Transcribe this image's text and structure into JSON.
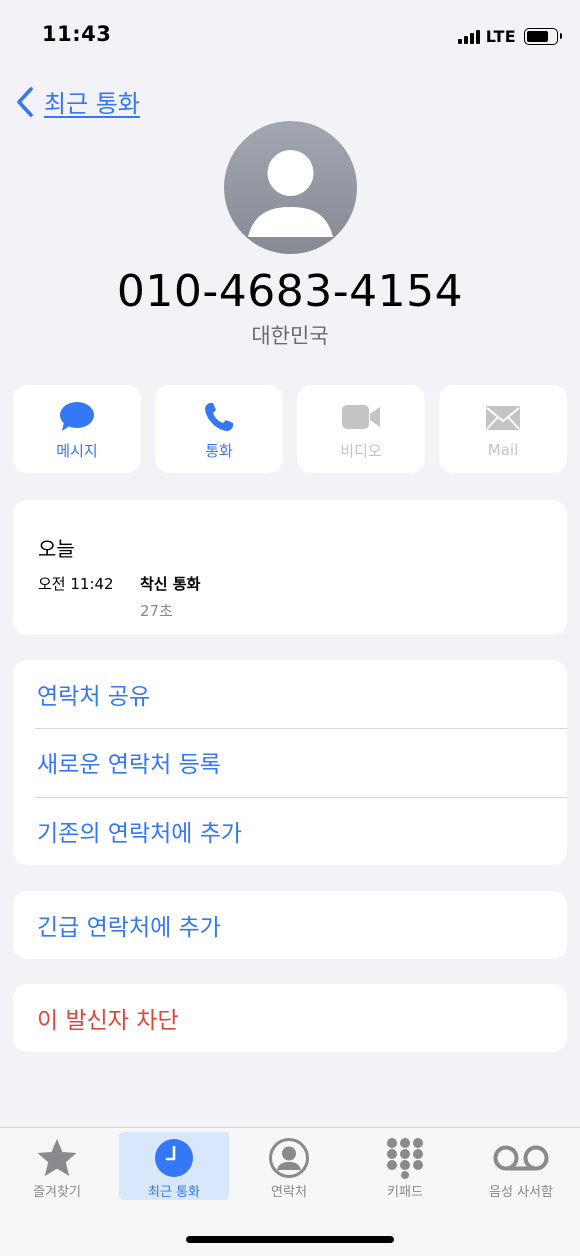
{
  "status_bar": {
    "time": "11:43",
    "network": "LTE"
  },
  "nav": {
    "back_label": "최근 통화"
  },
  "contact": {
    "phone_number": "010-4683-4154",
    "country": "대한민국"
  },
  "actions": [
    {
      "label": "메시지",
      "icon": "message-bubble-icon",
      "enabled": true
    },
    {
      "label": "통화",
      "icon": "phone-icon",
      "enabled": true
    },
    {
      "label": "비디오",
      "icon": "video-camera-icon",
      "enabled": false
    },
    {
      "label": "Mail",
      "icon": "envelope-icon",
      "enabled": false
    }
  ],
  "history": {
    "day": "오늘",
    "time": "오전 11:42",
    "call_type": "착신 통화",
    "duration": "27초"
  },
  "options": [
    "연락처 공유",
    "새로운 연락처 등록",
    "기존의 연락처에 추가"
  ],
  "emergency": "긴급 연락처에 추가",
  "block": "이 발신자 차단",
  "tabs": [
    {
      "label": "즐겨찾기",
      "icon": "star-icon"
    },
    {
      "label": "최근 통화",
      "icon": "clock-icon",
      "selected": true
    },
    {
      "label": "연락처",
      "icon": "person-circle-icon"
    },
    {
      "label": "키패드",
      "icon": "keypad-icon"
    },
    {
      "label": "음성 사서함",
      "icon": "voicemail-icon"
    }
  ],
  "colors": {
    "accent": "#3478f6",
    "destructive": "#e0453a",
    "background": "#f2f2f7"
  }
}
